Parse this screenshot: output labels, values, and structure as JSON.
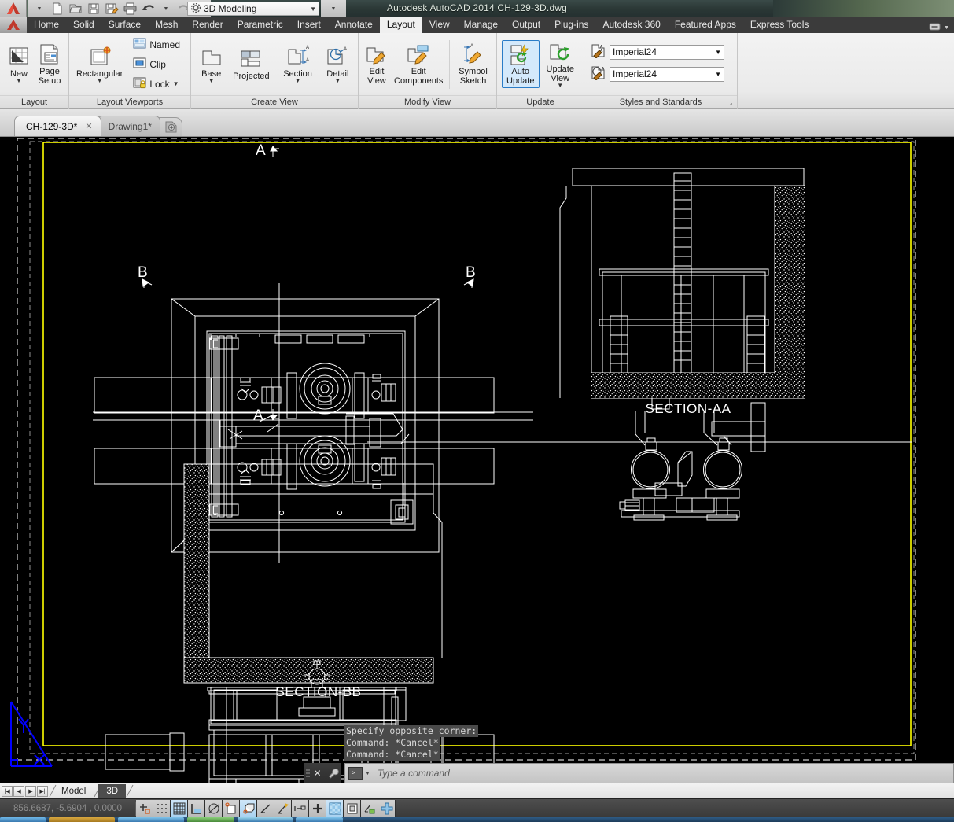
{
  "titlebar": {
    "title": "Autodesk AutoCAD 2014    CH-129-3D.dwg",
    "workspace": "3D Modeling",
    "qat": [
      {
        "name": "new-file",
        "glyph": "🗋"
      },
      {
        "name": "open-file",
        "glyph": "📂"
      },
      {
        "name": "save-file",
        "glyph": "💾"
      },
      {
        "name": "save-as",
        "glyph": "💾"
      },
      {
        "name": "plot",
        "glyph": "🖨"
      },
      {
        "name": "undo",
        "glyph": "↶"
      },
      {
        "name": "redo",
        "glyph": "↷"
      }
    ]
  },
  "ribbon_tabs": [
    {
      "label": "Home",
      "active": false
    },
    {
      "label": "Solid",
      "active": false
    },
    {
      "label": "Surface",
      "active": false
    },
    {
      "label": "Mesh",
      "active": false
    },
    {
      "label": "Render",
      "active": false
    },
    {
      "label": "Parametric",
      "active": false
    },
    {
      "label": "Insert",
      "active": false
    },
    {
      "label": "Annotate",
      "active": false
    },
    {
      "label": "Layout",
      "active": true
    },
    {
      "label": "View",
      "active": false
    },
    {
      "label": "Manage",
      "active": false
    },
    {
      "label": "Output",
      "active": false
    },
    {
      "label": "Plug-ins",
      "active": false
    },
    {
      "label": "Autodesk 360",
      "active": false
    },
    {
      "label": "Featured Apps",
      "active": false
    },
    {
      "label": "Express Tools",
      "active": false
    }
  ],
  "ribbon_panels": {
    "layout": {
      "title": "Layout",
      "new_label": "New",
      "page_setup_label": "Page\nSetup"
    },
    "layout_viewports": {
      "title": "Layout Viewports",
      "rectangular_label": "Rectangular",
      "named_label": "Named",
      "clip_label": "Clip",
      "lock_label": "Lock"
    },
    "create_view": {
      "title": "Create View",
      "base_label": "Base",
      "projected_label": "Projected",
      "section_label": "Section",
      "detail_label": "Detail"
    },
    "modify_view": {
      "title": "Modify View",
      "edit_view_label": "Edit\nView",
      "edit_components_label": "Edit\nComponents",
      "symbol_sketch_label": "Symbol\nSketch"
    },
    "update": {
      "title": "Update",
      "auto_update_label": "Auto\nUpdate",
      "update_view_label": "Update\nView",
      "auto_update_selected": true
    },
    "styles_and_standards": {
      "title": "Styles and Standards",
      "section_style": "Imperial24",
      "detail_style": "Imperial24"
    }
  },
  "file_tabs": [
    {
      "label": "CH-129-3D*",
      "active": true,
      "closable": true
    },
    {
      "label": "Drawing1*",
      "active": false,
      "closable": false
    }
  ],
  "drawing": {
    "top_view_markers": {
      "section_a_top": "A",
      "section_a_bottom": "A",
      "section_b_left": "B",
      "section_b_right": "B"
    },
    "section_aa_label": "SECTION-AA",
    "section_bb_label": "SECTION-BB",
    "colors": {
      "background": "#000000",
      "geometry": "#ffffff",
      "viewport_border": "#ffff00",
      "ucs_icon": "#0000ff",
      "paper_edge": "#ffffff"
    }
  },
  "command_line": {
    "history": [
      "Specify opposite corner:",
      "Command: *Cancel*",
      "Command: *Cancel*"
    ],
    "placeholder": "Type a command",
    "prompt_glyph": ">_"
  },
  "layout_tabs": {
    "nav": [
      "◀▐",
      "◀",
      "▶",
      "▐▶"
    ],
    "tabs": [
      {
        "label": "Model",
        "active": false
      },
      {
        "label": "3D",
        "active": true
      }
    ]
  },
  "statusbar": {
    "coordinates": "856.6687, -5.6904 , 0.0000",
    "toggles": [
      {
        "name": "infer-constraints-toggle",
        "on": false
      },
      {
        "name": "snap-mode-toggle",
        "on": false
      },
      {
        "name": "grid-display-toggle",
        "on": true
      },
      {
        "name": "ortho-mode-toggle",
        "on": false
      },
      {
        "name": "polar-tracking-toggle",
        "on": false
      },
      {
        "name": "object-snap-toggle",
        "on": false
      },
      {
        "name": "3d-object-snap-toggle",
        "on": true
      },
      {
        "name": "object-snap-tracking-toggle",
        "on": false
      },
      {
        "name": "dynamic-ucs-toggle",
        "on": false
      },
      {
        "name": "dynamic-input-toggle",
        "on": false
      },
      {
        "name": "lineweight-toggle",
        "on": false
      },
      {
        "name": "transparency-toggle",
        "on": true
      },
      {
        "name": "selection-cycling-toggle",
        "on": false
      },
      {
        "name": "annotation-monitor-toggle",
        "on": false
      },
      {
        "name": "workspace-switch-toggle",
        "on": false
      }
    ]
  }
}
